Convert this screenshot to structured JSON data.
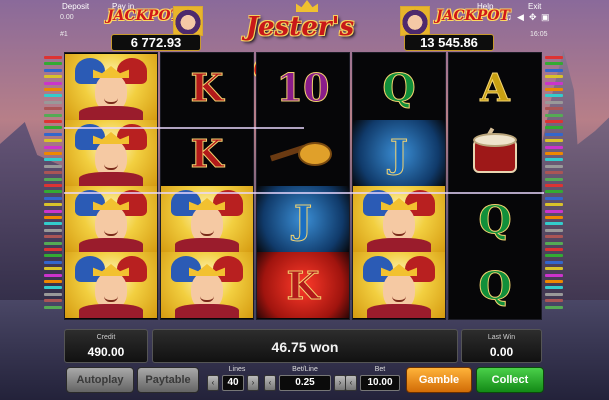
{
  "top": {
    "deposit": "Deposit",
    "pay_in": "Pay in",
    "help": "Help",
    "exit": "Exit",
    "balance_small": "0.00",
    "left_code": "#1",
    "time": "16:05"
  },
  "logo_text": "Jester's Crown",
  "jackpots": [
    {
      "title": "JACKPOT",
      "value": "6 772.93"
    },
    {
      "title": "JACKPOT",
      "value": "13 545.86"
    }
  ],
  "reels": [
    [
      "jester",
      "jester",
      "jester",
      "jester"
    ],
    [
      "K",
      "K",
      "jester",
      "jester"
    ],
    [
      "10",
      "lute",
      "J",
      "K"
    ],
    [
      "Q",
      "J",
      "jester",
      "jester"
    ],
    [
      "A",
      "drum",
      "Q",
      "Q"
    ]
  ],
  "highlights": {
    "2-2": "blue",
    "2-3": "red",
    "3-1": "blue"
  },
  "panel": {
    "credit_label": "Credit",
    "credit_value": "490.00",
    "won_text": "46.75 won",
    "last_win_label": "Last Win",
    "last_win_value": "0.00"
  },
  "controls": {
    "autoplay": "Autoplay",
    "paytable": "Paytable",
    "lines_label": "Lines",
    "lines_value": "40",
    "bet_line_label": "Bet/Line",
    "bet_line_value": "0.25",
    "bet_label": "Bet",
    "bet_value": "10.00",
    "gamble": "Gamble",
    "collect": "Collect"
  },
  "colors": {
    "K": "#b21a1a",
    "10": "#8a1c8a",
    "Q": "#118f3a",
    "J": "#1b6fc2",
    "A": "#c9a112",
    "collect": "#138a16",
    "gamble": "#d26c06"
  }
}
